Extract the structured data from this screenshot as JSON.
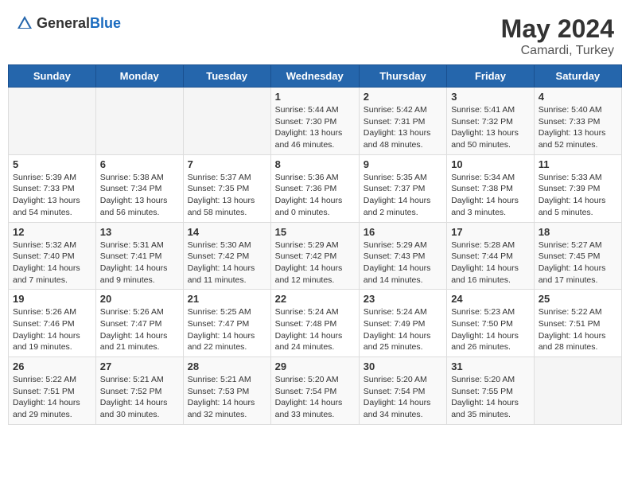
{
  "header": {
    "logo_general": "General",
    "logo_blue": "Blue",
    "month_year": "May 2024",
    "location": "Camardi, Turkey"
  },
  "days_of_week": [
    "Sunday",
    "Monday",
    "Tuesday",
    "Wednesday",
    "Thursday",
    "Friday",
    "Saturday"
  ],
  "weeks": [
    [
      {
        "day": "",
        "content": ""
      },
      {
        "day": "",
        "content": ""
      },
      {
        "day": "",
        "content": ""
      },
      {
        "day": "1",
        "content": "Sunrise: 5:44 AM\nSunset: 7:30 PM\nDaylight: 13 hours\nand 46 minutes."
      },
      {
        "day": "2",
        "content": "Sunrise: 5:42 AM\nSunset: 7:31 PM\nDaylight: 13 hours\nand 48 minutes."
      },
      {
        "day": "3",
        "content": "Sunrise: 5:41 AM\nSunset: 7:32 PM\nDaylight: 13 hours\nand 50 minutes."
      },
      {
        "day": "4",
        "content": "Sunrise: 5:40 AM\nSunset: 7:33 PM\nDaylight: 13 hours\nand 52 minutes."
      }
    ],
    [
      {
        "day": "5",
        "content": "Sunrise: 5:39 AM\nSunset: 7:33 PM\nDaylight: 13 hours\nand 54 minutes."
      },
      {
        "day": "6",
        "content": "Sunrise: 5:38 AM\nSunset: 7:34 PM\nDaylight: 13 hours\nand 56 minutes."
      },
      {
        "day": "7",
        "content": "Sunrise: 5:37 AM\nSunset: 7:35 PM\nDaylight: 13 hours\nand 58 minutes."
      },
      {
        "day": "8",
        "content": "Sunrise: 5:36 AM\nSunset: 7:36 PM\nDaylight: 14 hours\nand 0 minutes."
      },
      {
        "day": "9",
        "content": "Sunrise: 5:35 AM\nSunset: 7:37 PM\nDaylight: 14 hours\nand 2 minutes."
      },
      {
        "day": "10",
        "content": "Sunrise: 5:34 AM\nSunset: 7:38 PM\nDaylight: 14 hours\nand 3 minutes."
      },
      {
        "day": "11",
        "content": "Sunrise: 5:33 AM\nSunset: 7:39 PM\nDaylight: 14 hours\nand 5 minutes."
      }
    ],
    [
      {
        "day": "12",
        "content": "Sunrise: 5:32 AM\nSunset: 7:40 PM\nDaylight: 14 hours\nand 7 minutes."
      },
      {
        "day": "13",
        "content": "Sunrise: 5:31 AM\nSunset: 7:41 PM\nDaylight: 14 hours\nand 9 minutes."
      },
      {
        "day": "14",
        "content": "Sunrise: 5:30 AM\nSunset: 7:42 PM\nDaylight: 14 hours\nand 11 minutes."
      },
      {
        "day": "15",
        "content": "Sunrise: 5:29 AM\nSunset: 7:42 PM\nDaylight: 14 hours\nand 12 minutes."
      },
      {
        "day": "16",
        "content": "Sunrise: 5:29 AM\nSunset: 7:43 PM\nDaylight: 14 hours\nand 14 minutes."
      },
      {
        "day": "17",
        "content": "Sunrise: 5:28 AM\nSunset: 7:44 PM\nDaylight: 14 hours\nand 16 minutes."
      },
      {
        "day": "18",
        "content": "Sunrise: 5:27 AM\nSunset: 7:45 PM\nDaylight: 14 hours\nand 17 minutes."
      }
    ],
    [
      {
        "day": "19",
        "content": "Sunrise: 5:26 AM\nSunset: 7:46 PM\nDaylight: 14 hours\nand 19 minutes."
      },
      {
        "day": "20",
        "content": "Sunrise: 5:26 AM\nSunset: 7:47 PM\nDaylight: 14 hours\nand 21 minutes."
      },
      {
        "day": "21",
        "content": "Sunrise: 5:25 AM\nSunset: 7:47 PM\nDaylight: 14 hours\nand 22 minutes."
      },
      {
        "day": "22",
        "content": "Sunrise: 5:24 AM\nSunset: 7:48 PM\nDaylight: 14 hours\nand 24 minutes."
      },
      {
        "day": "23",
        "content": "Sunrise: 5:24 AM\nSunset: 7:49 PM\nDaylight: 14 hours\nand 25 minutes."
      },
      {
        "day": "24",
        "content": "Sunrise: 5:23 AM\nSunset: 7:50 PM\nDaylight: 14 hours\nand 26 minutes."
      },
      {
        "day": "25",
        "content": "Sunrise: 5:22 AM\nSunset: 7:51 PM\nDaylight: 14 hours\nand 28 minutes."
      }
    ],
    [
      {
        "day": "26",
        "content": "Sunrise: 5:22 AM\nSunset: 7:51 PM\nDaylight: 14 hours\nand 29 minutes."
      },
      {
        "day": "27",
        "content": "Sunrise: 5:21 AM\nSunset: 7:52 PM\nDaylight: 14 hours\nand 30 minutes."
      },
      {
        "day": "28",
        "content": "Sunrise: 5:21 AM\nSunset: 7:53 PM\nDaylight: 14 hours\nand 32 minutes."
      },
      {
        "day": "29",
        "content": "Sunrise: 5:20 AM\nSunset: 7:54 PM\nDaylight: 14 hours\nand 33 minutes."
      },
      {
        "day": "30",
        "content": "Sunrise: 5:20 AM\nSunset: 7:54 PM\nDaylight: 14 hours\nand 34 minutes."
      },
      {
        "day": "31",
        "content": "Sunrise: 5:20 AM\nSunset: 7:55 PM\nDaylight: 14 hours\nand 35 minutes."
      },
      {
        "day": "",
        "content": ""
      }
    ]
  ]
}
